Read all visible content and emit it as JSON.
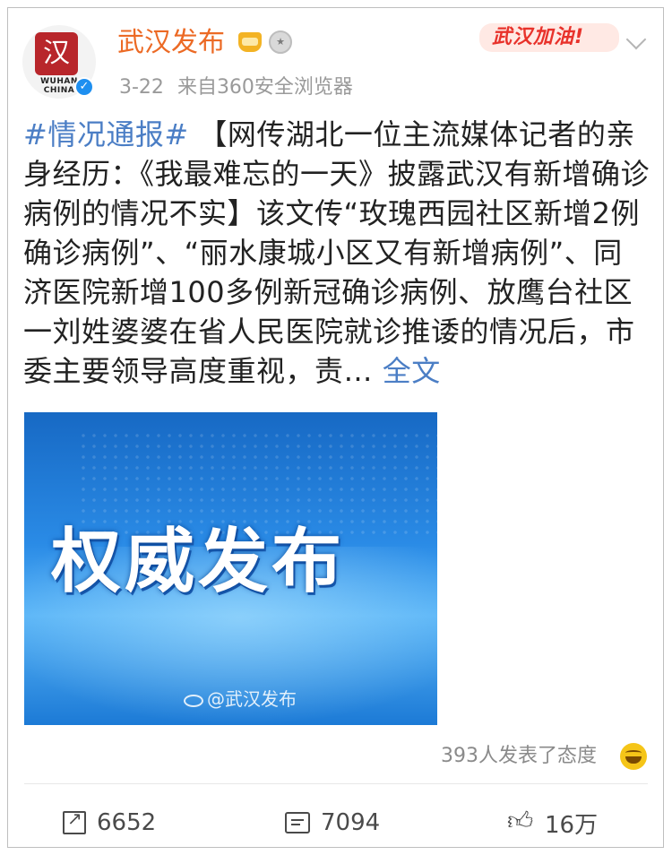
{
  "header": {
    "avatar_seal_char": "汉",
    "avatar_wordmark": "WUHAN CHINA",
    "account_name": "武汉发布",
    "badges": [
      "crown-badge-icon",
      "medal-badge-icon"
    ],
    "time": "3-22",
    "source": "来自360安全浏览器",
    "cheer_label": "武汉加油!"
  },
  "post": {
    "tag": "#情况通报#",
    "text": "【网传湖北一位主流媒体记者的亲身经历：《我最难忘的一天》披露武汉有新增确诊病例的情况不实】该文传“玫瑰西园社区新增2例确诊病例”、“丽水康城小区又有新增病例”、同济医院新增100多例新冠确诊病例、放鹰台社区一刘姓婆婆在省人民医院就诊推诿的情况后，市委主要领导高度重视，责…",
    "more_label": "全文"
  },
  "image": {
    "title": "权威发布",
    "watermark": "@武汉发布"
  },
  "reactions": {
    "attitude_text": "393人发表了态度",
    "emoji": "grin-emoji-icon"
  },
  "actions": {
    "share_count": "6652",
    "comment_count": "7094",
    "like_count": "16万"
  },
  "colors": {
    "name": "#ec6a25",
    "link": "#4b7ec5",
    "cheer": "#e8322b",
    "verified": "#1e8ff0"
  }
}
